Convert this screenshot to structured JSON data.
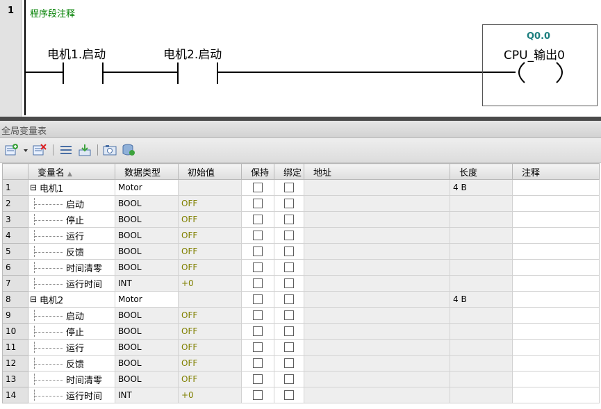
{
  "network": {
    "number": "1",
    "comment": "程序段注释",
    "contacts": [
      {
        "label": "电机1.启动"
      },
      {
        "label": "电机2.启动"
      }
    ],
    "coil": {
      "address": "Q0.0",
      "label": "CPU_输出0"
    }
  },
  "panel": {
    "title": "全局变量表"
  },
  "toolbar": {
    "icons": [
      "add-variable-icon",
      "dropdown-arrow-icon",
      "delete-variable-icon",
      "list-view-icon",
      "import-icon",
      "snapshot-icon",
      "database-icon"
    ]
  },
  "table": {
    "headers": [
      "",
      "变量名",
      "数据类型",
      "初始值",
      "保持",
      "绑定",
      "地址",
      "长度",
      "注释"
    ],
    "rows": [
      {
        "num": "1",
        "name": "电机1",
        "type": "Motor",
        "init": "",
        "len": "4 B",
        "kind": "parent"
      },
      {
        "num": "2",
        "name": "启动",
        "type": "BOOL",
        "init": "OFF",
        "len": "",
        "kind": "child"
      },
      {
        "num": "3",
        "name": "停止",
        "type": "BOOL",
        "init": "OFF",
        "len": "",
        "kind": "child"
      },
      {
        "num": "4",
        "name": "运行",
        "type": "BOOL",
        "init": "OFF",
        "len": "",
        "kind": "child"
      },
      {
        "num": "5",
        "name": "反馈",
        "type": "BOOL",
        "init": "OFF",
        "len": "",
        "kind": "child"
      },
      {
        "num": "6",
        "name": "时间清零",
        "type": "BOOL",
        "init": "OFF",
        "len": "",
        "kind": "child"
      },
      {
        "num": "7",
        "name": "运行时间",
        "type": "INT",
        "init": "+0",
        "len": "",
        "kind": "child"
      },
      {
        "num": "8",
        "name": "电机2",
        "type": "Motor",
        "init": "",
        "len": "4 B",
        "kind": "parent"
      },
      {
        "num": "9",
        "name": "启动",
        "type": "BOOL",
        "init": "OFF",
        "len": "",
        "kind": "child"
      },
      {
        "num": "10",
        "name": "停止",
        "type": "BOOL",
        "init": "OFF",
        "len": "",
        "kind": "child"
      },
      {
        "num": "11",
        "name": "运行",
        "type": "BOOL",
        "init": "OFF",
        "len": "",
        "kind": "child"
      },
      {
        "num": "12",
        "name": "反馈",
        "type": "BOOL",
        "init": "OFF",
        "len": "",
        "kind": "child"
      },
      {
        "num": "13",
        "name": "时间清零",
        "type": "BOOL",
        "init": "OFF",
        "len": "",
        "kind": "child"
      },
      {
        "num": "14",
        "name": "运行时间",
        "type": "INT",
        "init": "+0",
        "len": "",
        "kind": "child"
      }
    ]
  },
  "colors": {
    "comment": "#008000",
    "coil_address": "#1c7e7e",
    "init_value": "#808000"
  }
}
